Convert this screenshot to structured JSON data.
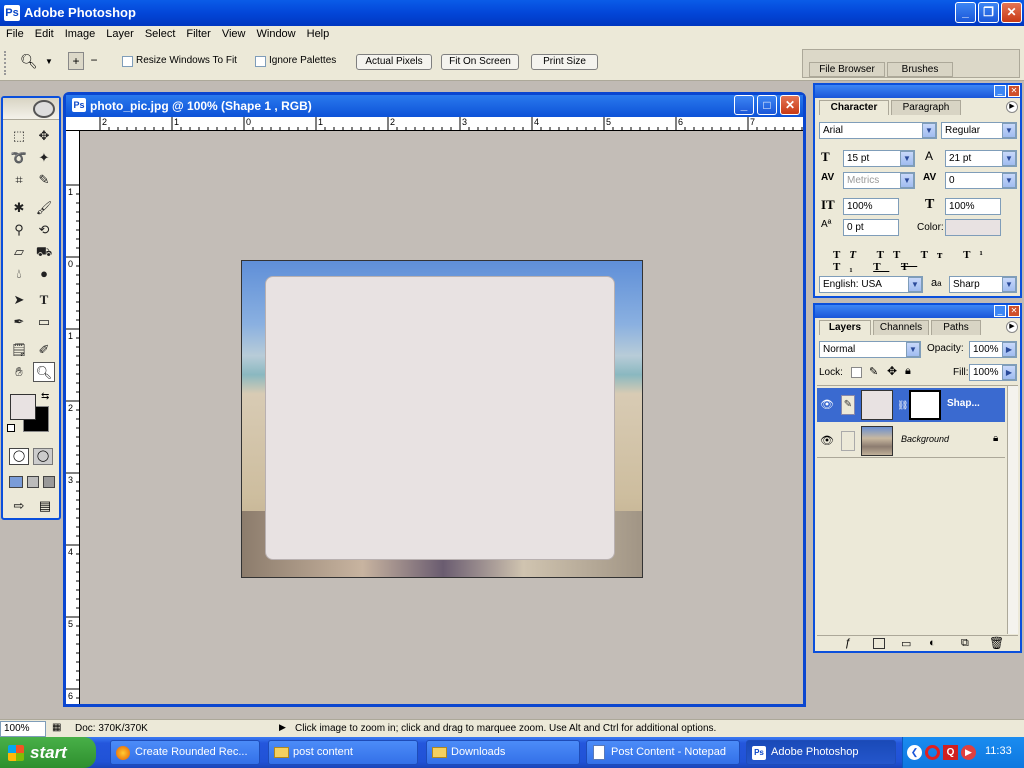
{
  "app": {
    "title": "Adobe Photoshop"
  },
  "menu": [
    "File",
    "Edit",
    "Image",
    "Layer",
    "Select",
    "Filter",
    "View",
    "Window",
    "Help"
  ],
  "options": {
    "resize_windows": "Resize Windows To Fit",
    "ignore_palettes": "Ignore Palettes",
    "actual_pixels": "Actual Pixels",
    "fit_on_screen": "Fit On Screen",
    "print_size": "Print Size"
  },
  "palette_well": {
    "file_browser": "File Browser",
    "brushes": "Brushes"
  },
  "document": {
    "title": "photo_pic.jpg @ 100% (Shape 1 , RGB)",
    "ruler_h": [
      "2",
      "1",
      "0",
      "1",
      "2",
      "3",
      "4",
      "5",
      "6",
      "7"
    ],
    "ruler_v": [
      "1",
      "0",
      "1",
      "2",
      "3",
      "4",
      "5",
      "6"
    ]
  },
  "character": {
    "tab_character": "Character",
    "tab_paragraph": "Paragraph",
    "font": "Arial",
    "style": "Regular",
    "size": "15 pt",
    "leading": "21 pt",
    "kerning": "Metrics",
    "tracking": "0",
    "vscale": "100%",
    "hscale": "100%",
    "baseline": "0 pt",
    "color_label": "Color:",
    "language": "English: USA",
    "antialias": "Sharp",
    "aa_label": "a",
    "aa_label2": "a"
  },
  "layers": {
    "tab_layers": "Layers",
    "tab_channels": "Channels",
    "tab_paths": "Paths",
    "blend": "Normal",
    "opacity_label": "Opacity:",
    "opacity": "100%",
    "lock_label": "Lock:",
    "fill_label": "Fill:",
    "fill": "100%",
    "items": [
      {
        "name": "Shap..."
      },
      {
        "name": "Background"
      }
    ]
  },
  "status": {
    "zoom": "100%",
    "doc": "Doc: 370K/370K",
    "hint": "Click image to zoom in; click and drag to marquee zoom.  Use Alt and Ctrl for additional options."
  },
  "taskbar": {
    "start": "start",
    "tasks": [
      "Create Rounded Rec...",
      "post content",
      "Downloads",
      "Post Content - Notepad",
      "Adobe Photoshop"
    ],
    "clock": "11:33"
  },
  "colors": {
    "xp_blue": "#0a4fdc",
    "shape_fill": "#e8e2e2",
    "canvas_bg": "#c3bdb7"
  }
}
